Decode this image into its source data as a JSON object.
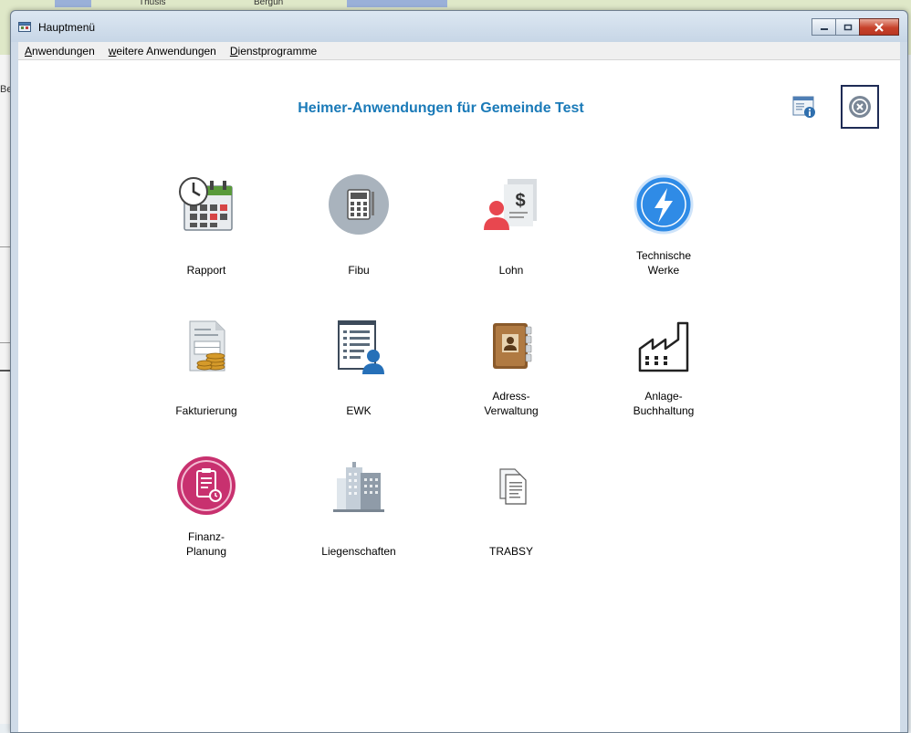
{
  "background": {
    "map_labels": [
      "Thusis",
      "Bergün"
    ],
    "side_text": "Be"
  },
  "window": {
    "title": "Hauptmenü",
    "controls": {
      "minimize": "minimize",
      "maximize": "maximize",
      "close": "close"
    }
  },
  "menu": {
    "items": [
      {
        "first": "A",
        "rest": "nwendungen"
      },
      {
        "first": "w",
        "rest": "eitere Anwendungen"
      },
      {
        "first": "D",
        "rest": "ienstprogramme"
      }
    ]
  },
  "header": {
    "title": "Heimer-Anwendungen für Gemeinde Test"
  },
  "tiles": [
    {
      "line1": "Rapport",
      "line2": ""
    },
    {
      "line1": "Fibu",
      "line2": ""
    },
    {
      "line1": "Lohn",
      "line2": ""
    },
    {
      "line1": "Technische",
      "line2": "Werke"
    },
    {
      "line1": "Fakturierung",
      "line2": ""
    },
    {
      "line1": "EWK",
      "line2": ""
    },
    {
      "line1": "Adress-",
      "line2": "Verwaltung"
    },
    {
      "line1": "Anlage-",
      "line2": "Buchhaltung"
    },
    {
      "line1": "Finanz-",
      "line2": "Planung"
    },
    {
      "line1": "Liegenschaften",
      "line2": ""
    },
    {
      "line1": "TRABSY",
      "line2": ""
    }
  ],
  "colors": {
    "title_blue": "#1a7ab8",
    "close_border": "#1e2b55"
  }
}
